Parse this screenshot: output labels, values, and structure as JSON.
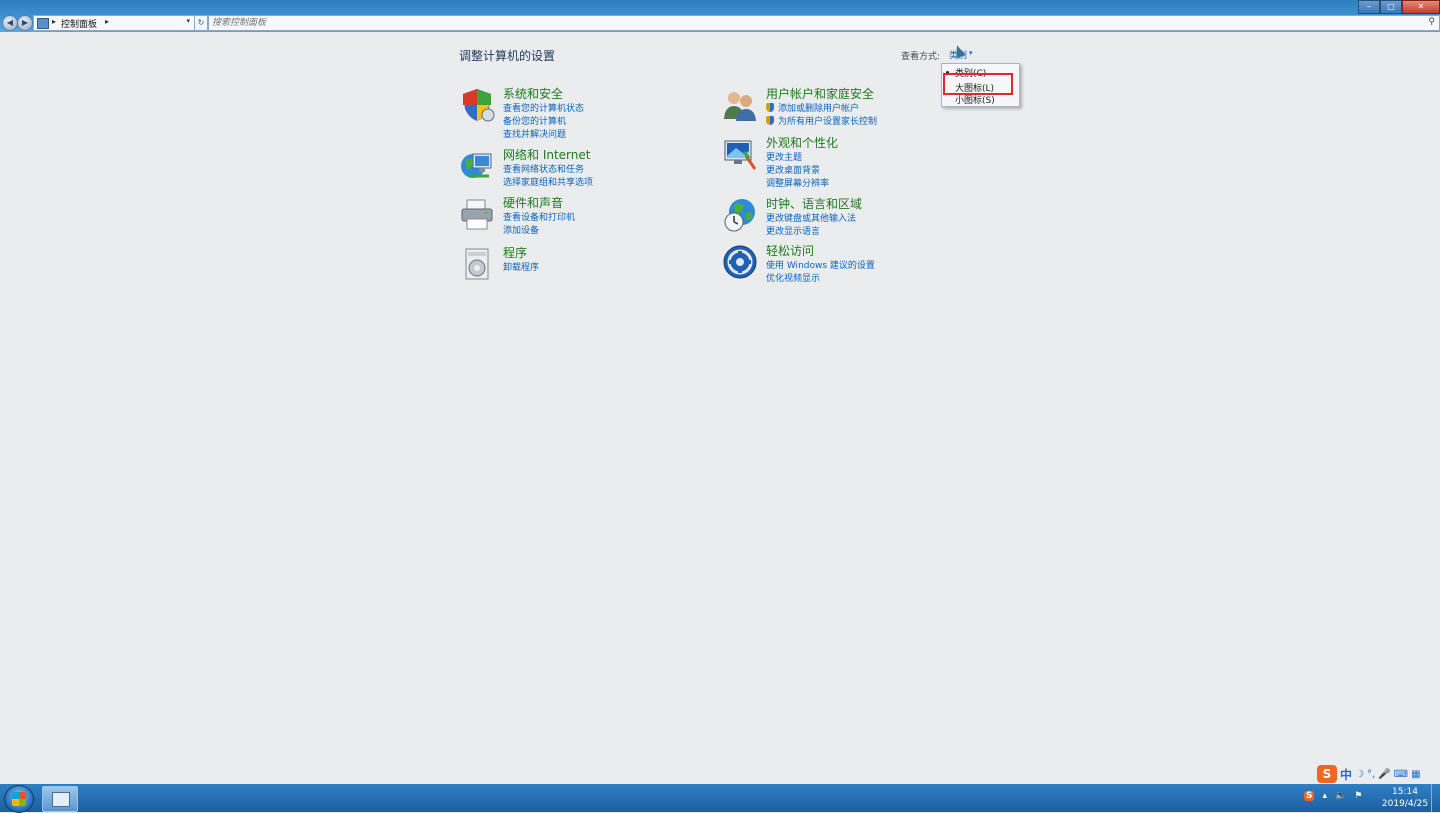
{
  "address_bar": {
    "breadcrumb": "控制面板",
    "search_placeholder": "搜索控制面板"
  },
  "header": {
    "title": "调整计算机的设置",
    "view_by_label": "查看方式:",
    "view_by_value": "类别"
  },
  "view_menu": {
    "items": [
      "类别(C)",
      "大图标(L)",
      "小图标(S)"
    ],
    "selected": "类别(C)",
    "highlighted": "大图标(L)"
  },
  "categories": [
    {
      "title": "系统和安全",
      "links": [
        "查看您的计算机状态",
        "备份您的计算机",
        "查找并解决问题"
      ],
      "icon": "shield-icon"
    },
    {
      "title": "网络和 Internet",
      "links": [
        "查看网络状态和任务",
        "选择家庭组和共享选项"
      ],
      "icon": "network-globe-icon"
    },
    {
      "title": "硬件和声音",
      "links": [
        "查看设备和打印机",
        "添加设备"
      ],
      "icon": "printer-icon"
    },
    {
      "title": "程序",
      "links": [
        "卸载程序"
      ],
      "icon": "programs-icon"
    },
    {
      "title": "用户帐户和家庭安全",
      "links": [
        "添加或删除用户帐户",
        "为所有用户设置家长控制"
      ],
      "icon": "users-icon"
    },
    {
      "title": "外观和个性化",
      "links": [
        "更改主题",
        "更改桌面背景",
        "调整屏幕分辨率"
      ],
      "icon": "appearance-icon"
    },
    {
      "title": "时钟、语言和区域",
      "links": [
        "更改键盘或其他输入法",
        "更改显示语言"
      ],
      "icon": "clock-globe-icon"
    },
    {
      "title": "轻松访问",
      "links": [
        "使用 Windows 建议的设置",
        "优化视频显示"
      ],
      "icon": "ease-of-access-icon"
    }
  ],
  "taskbar": {
    "time": "15:14",
    "date": "2019/4/25",
    "ime_mode": "中"
  },
  "colors": {
    "category_title": "#1f7a1f",
    "link": "#0a63c0",
    "highlight_border": "#e0282e"
  }
}
